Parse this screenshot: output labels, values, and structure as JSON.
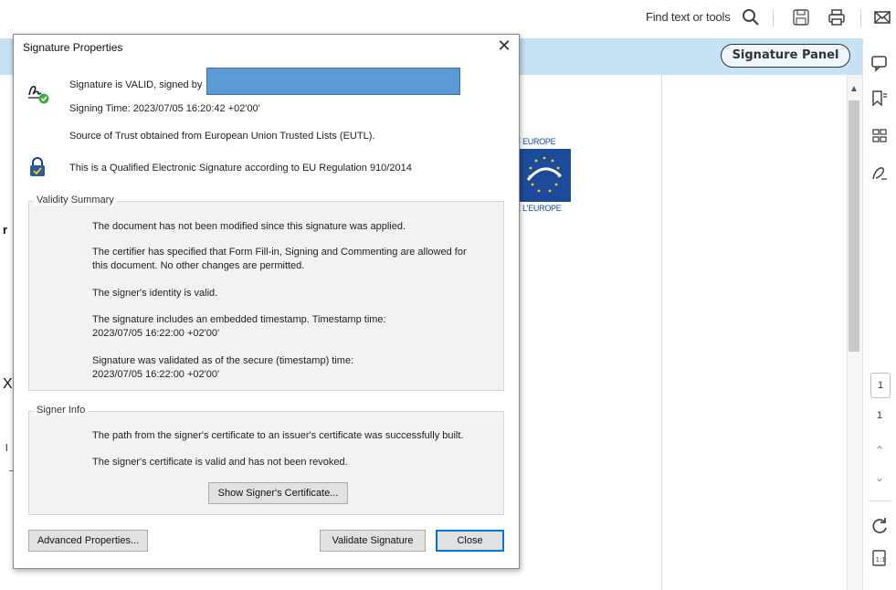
{
  "toolbar": {
    "find_label": "Find text or tools",
    "icons": [
      "search-icon",
      "save-icon",
      "print-icon",
      "mail-icon"
    ]
  },
  "message_bar": {
    "signature_panel_label": "Signature Panel",
    "color": "#c7e1f5"
  },
  "document": {
    "logo_top_text": "OF EUROPE",
    "logo_bottom_text": "DE L'EUROPE"
  },
  "right_rail": {
    "icons": [
      "comment-icon",
      "bookmark-icon",
      "thumbnails-icon",
      "signature-icon",
      "rotate-icon",
      "fit-page-icon"
    ],
    "current_page": "1",
    "total_pages": "1"
  },
  "dialog": {
    "title": "Signature Properties",
    "close_glyph": "✕",
    "status_line": "Signature is VALID, signed by",
    "signing_time": "Signing Time:  2023/07/05 16:20:42 +02'00'",
    "trust_source": "Source of Trust obtained from European Union Trusted Lists (EUTL).",
    "qualified_line": "This is a Qualified Electronic Signature according to EU Regulation 910/2014",
    "validity_summary": {
      "legend": "Validity Summary",
      "items": [
        "The document has not been modified since this signature was applied.",
        "The certifier has specified that Form Fill-in, Signing and Commenting are allowed for",
        "this document. No other changes are permitted.",
        "The signer's identity is valid.",
        "The signature includes an embedded timestamp. Timestamp time:",
        "2023/07/05 16:22:00 +02'00'",
        "Signature was validated as of the secure (timestamp) time:",
        "2023/07/05 16:22:00 +02'00'"
      ]
    },
    "signer_info": {
      "legend": "Signer Info",
      "items": [
        "The path from the signer's certificate to an issuer's certificate was successfully built.",
        "The signer's certificate is valid and has not been revoked."
      ],
      "show_certificate_label": "Show Signer's Certificate..."
    },
    "buttons": {
      "advanced": "Advanced Properties...",
      "validate": "Validate Signature",
      "close": "Close"
    },
    "accent_color": "#5b9bd5"
  }
}
